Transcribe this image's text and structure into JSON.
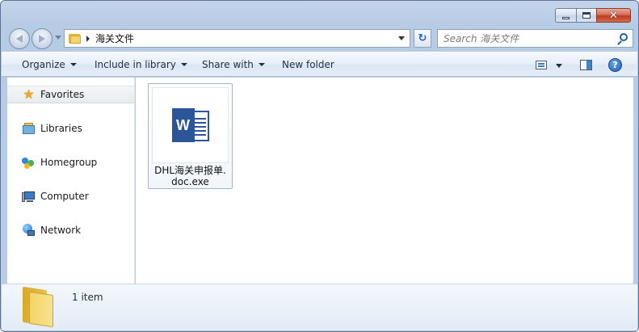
{
  "window": {
    "caption": {
      "minimize_icon": "minimize-icon",
      "maximize_icon": "maximize-icon",
      "close_icon": "close-icon",
      "close_glyph": "✕"
    }
  },
  "nav": {
    "address": {
      "crumbs": [
        "海关文件"
      ]
    },
    "refresh_glyph": "↻",
    "search": {
      "placeholder": "Search 海关文件"
    }
  },
  "toolbar": {
    "organize_label": "Organize",
    "include_label": "Include in library",
    "share_label": "Share with",
    "new_folder_label": "New folder",
    "help_glyph": "?"
  },
  "sidebar": {
    "items": [
      {
        "label": "Favorites",
        "icon": "star-icon",
        "selected": true
      },
      {
        "label": "Libraries",
        "icon": "libraries-icon"
      },
      {
        "label": "Homegroup",
        "icon": "homegroup-icon"
      },
      {
        "label": "Computer",
        "icon": "computer-icon"
      },
      {
        "label": "Network",
        "icon": "network-icon"
      }
    ]
  },
  "content": {
    "files": [
      {
        "name_line1": "DHL海关申报单.",
        "name_line2": "doc.exe",
        "icon": "word-document-icon",
        "icon_letter": "W"
      }
    ]
  },
  "details": {
    "count_text": "1 item"
  },
  "colors": {
    "word_blue": "#2b579a",
    "folder_yellow": "#f3d467",
    "frame_blue": "#b9cde6"
  }
}
